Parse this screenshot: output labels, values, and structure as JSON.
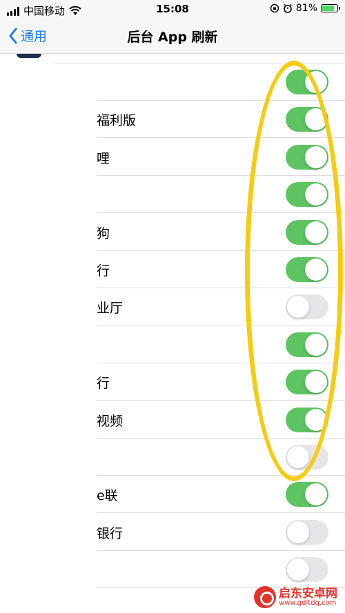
{
  "status_bar": {
    "carrier": "中国移动",
    "time": "15:08",
    "battery_percent": "81%",
    "battery_level": 0.81
  },
  "nav": {
    "back_label": "通用",
    "title": "后台 App 刷新"
  },
  "rows": [
    {
      "label": "",
      "on": true
    },
    {
      "label": "福利版",
      "on": true
    },
    {
      "label": "哩",
      "on": true
    },
    {
      "label": "",
      "on": true
    },
    {
      "label": "狗",
      "on": true
    },
    {
      "label": "行",
      "on": true
    },
    {
      "label": "业厅",
      "on": false
    },
    {
      "label": "",
      "on": true
    },
    {
      "label": "行",
      "on": true
    },
    {
      "label": "视频",
      "on": true
    },
    {
      "label": "",
      "on": false
    },
    {
      "label": "e联",
      "on": true
    },
    {
      "label": "银行",
      "on": false
    },
    {
      "label": "",
      "on": false
    }
  ],
  "watermark": {
    "name": "启东安卓网",
    "url": "www.qdltdq.com"
  },
  "colors": {
    "toggle_on": "#5ec462",
    "toggle_off": "#e6e6e9",
    "accent": "#1a7cf6",
    "highlight": "#f5cc10"
  }
}
